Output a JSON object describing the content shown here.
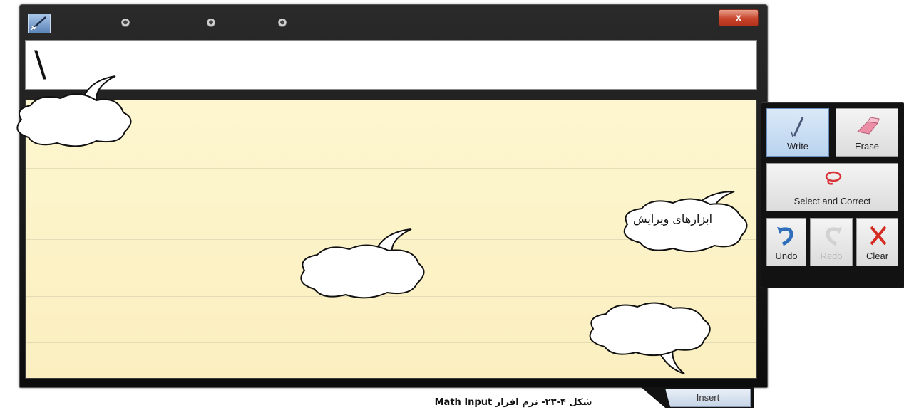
{
  "window": {
    "close_label": "x"
  },
  "preview": {
    "recognized_text": "\\"
  },
  "toolbar": {
    "write_label": "Write",
    "erase_label": "Erase",
    "select_correct_label": "Select and Correct",
    "undo_label": "Undo",
    "redo_label": "Redo",
    "clear_label": "Clear"
  },
  "insert": {
    "label": "Insert"
  },
  "callouts": {
    "edit_tools": "ابزارهای ویرایش"
  },
  "caption": "شکل ۴-۲۳- نرم افزار Math Input",
  "colors": {
    "pad_background": "#fcf3c7",
    "frame": "#121212",
    "active_tool": "#c6dcf2",
    "close_button": "#c8442b",
    "clear_red": "#d42b22",
    "undo_blue": "#2f6fb9"
  }
}
